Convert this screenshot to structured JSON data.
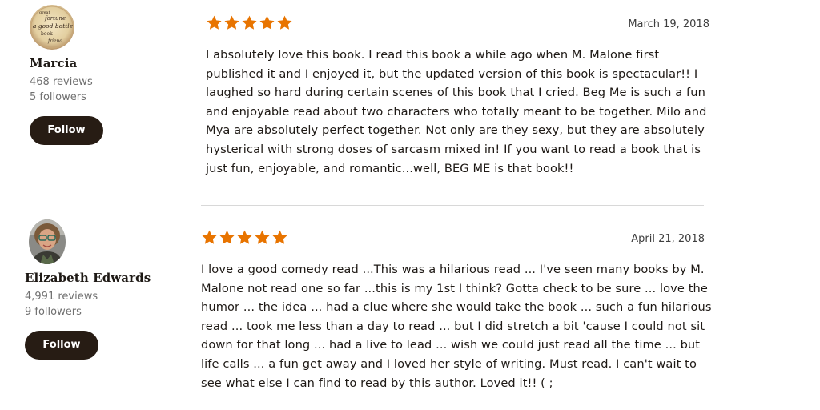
{
  "accent_color": "#e87400",
  "reviews": [
    {
      "reviewer": {
        "name": "Marcia",
        "reviews_count": "468 reviews",
        "followers": "5 followers",
        "follow_label": "Follow",
        "avatar_text": [
          "great",
          "fortune",
          "a good bottle",
          "book",
          "friend"
        ]
      },
      "rating": 5,
      "date": "March 19, 2018",
      "text": "I absolutely love this book. I read this book a while ago when M. Malone first published it and I enjoyed it, but the updated version of this book is spectacular!! I laughed so hard during certain scenes of this book that I cried. Beg Me is such a fun and enjoyable read about two characters who totally meant to be together. Milo and Mya are absolutely perfect together. Not only are they sexy, but they are absolutely hysterical with strong doses of sarcasm mixed in! If you want to read a book that is just fun, enjoyable, and romantic...well, BEG ME is that book!!"
    },
    {
      "reviewer": {
        "name": "Elizabeth Edwards",
        "reviews_count": "4,991 reviews",
        "followers": "9 followers",
        "follow_label": "Follow"
      },
      "rating": 5,
      "date": "April 21, 2018",
      "text": "I love a good comedy read ...This was a hilarious read ... I've seen many books by M. Malone not read one so far ...this is my 1st I think? Gotta check to be sure ... love the humor ... the idea ... had a clue where she would take the book ... such a fun hilarious read ... took me less than a day to read ... but I did stretch a bit 'cause I could not sit down for that long ... had a live to lead ... wish we could just read all the time ... but life calls ... a fun get away and I loved her style of writing. Must read. I can't wait to see what else I can find to read by this author. Loved it!! ( ;"
    }
  ]
}
